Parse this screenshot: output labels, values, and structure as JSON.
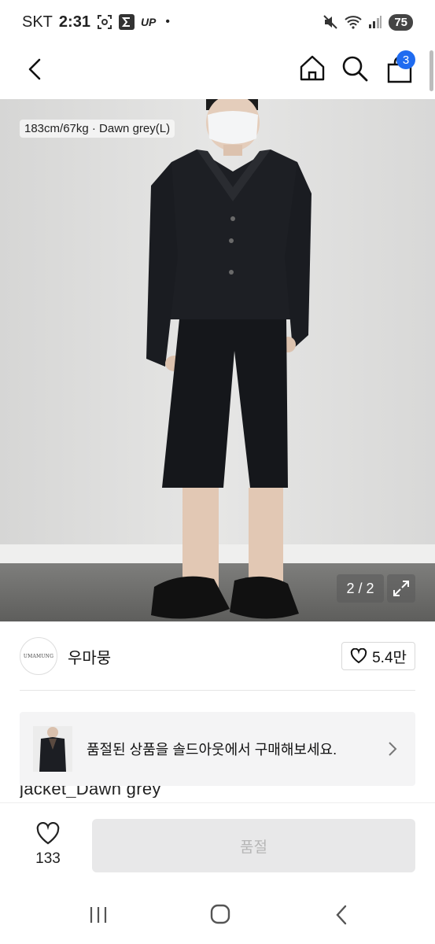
{
  "status_bar": {
    "carrier": "SKT",
    "time": "2:31",
    "up_label": "UP",
    "dot": "•",
    "battery": "75"
  },
  "header": {
    "cart_count": "3"
  },
  "product_image": {
    "size_tag": "183cm/67kg · Dawn grey(L)",
    "page_counter": "2 / 2"
  },
  "seller": {
    "logo_text": "UMAMUNG",
    "name": "우마뭉",
    "likes": "5.4만"
  },
  "banner": {
    "text": "품절된 상품을 솔드아웃에서 구매해보세요."
  },
  "product": {
    "title_partial": "jacket_Dawn grey"
  },
  "bottom_bar": {
    "wish_count": "133",
    "buy_button": "품절"
  },
  "colors": {
    "accent": "#1f6bf0",
    "disabled_bg": "#e8e8e9",
    "disabled_text": "#b6b6b6"
  },
  "icons": [
    "back-icon",
    "home-icon",
    "search-icon",
    "cart-icon",
    "expand-icon",
    "heart-icon",
    "chevron-right-icon",
    "recents-icon",
    "nav-home-icon",
    "nav-back-icon"
  ]
}
